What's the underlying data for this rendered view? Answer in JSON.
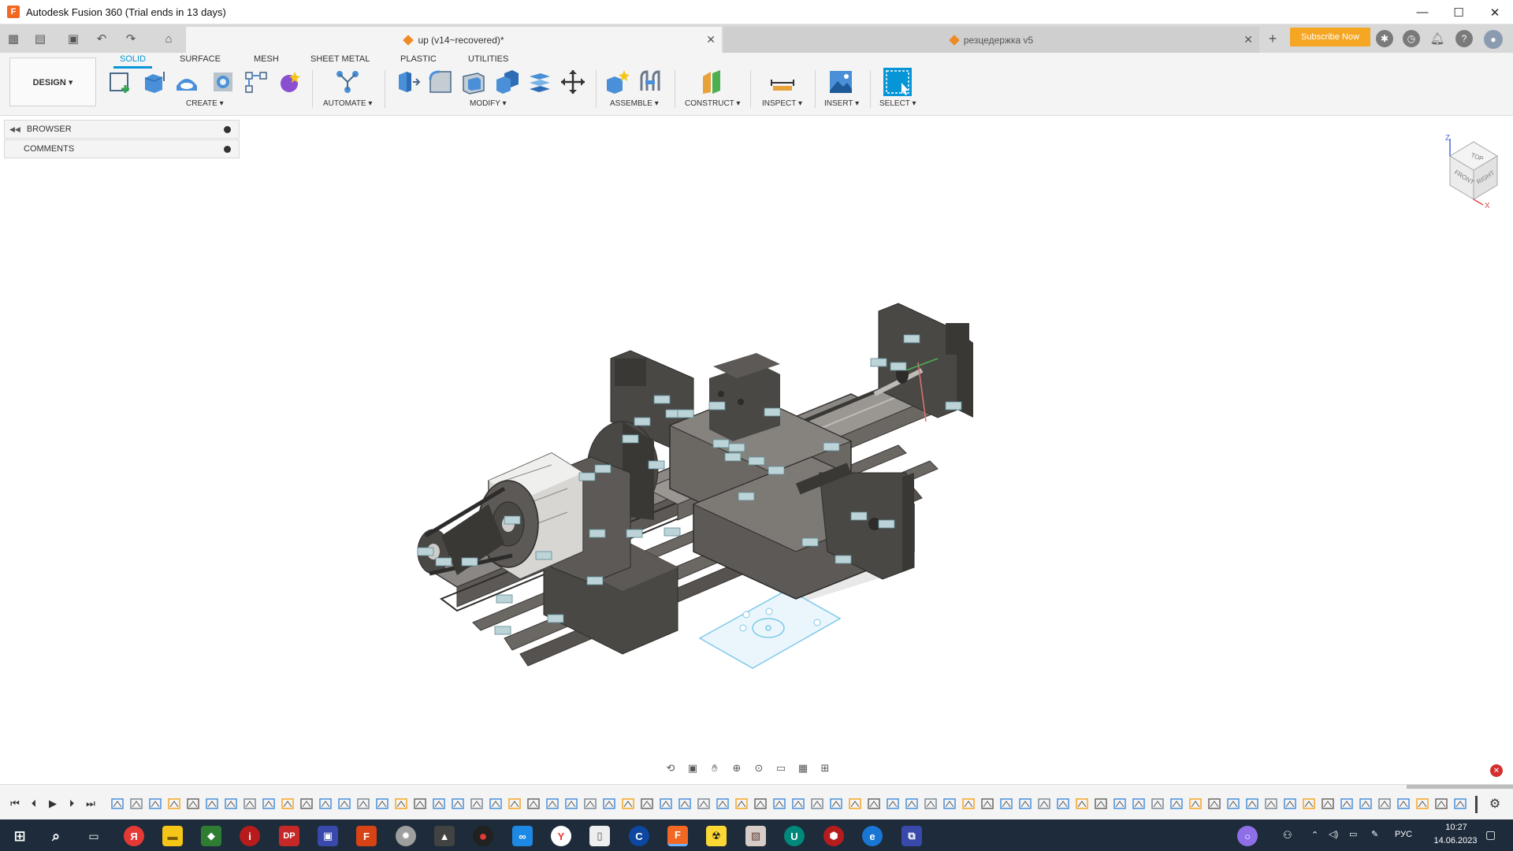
{
  "window": {
    "title": "Autodesk Fusion 360 (Trial ends in 13 days)",
    "controls": [
      "—",
      "☐",
      "✕"
    ]
  },
  "tabs": [
    {
      "label": "up (v14~recovered)*",
      "active": true
    },
    {
      "label": "резцедержка v5",
      "active": false
    }
  ],
  "subscribe_label": "Subscribe Now",
  "workspace": {
    "label": "DESIGN ▾"
  },
  "toolbar_tabs": [
    "SOLID",
    "SURFACE",
    "MESH",
    "SHEET METAL",
    "PLASTIC",
    "UTILITIES"
  ],
  "tool_groups": [
    {
      "label": "CREATE ▾"
    },
    {
      "label": "AUTOMATE ▾"
    },
    {
      "label": "MODIFY ▾"
    },
    {
      "label": "ASSEMBLE ▾"
    },
    {
      "label": "CONSTRUCT ▾"
    },
    {
      "label": "INSPECT ▾"
    },
    {
      "label": "INSERT ▾"
    },
    {
      "label": "SELECT ▾"
    }
  ],
  "panels": {
    "browser": "BROWSER",
    "comments": "COMMENTS"
  },
  "viewcube": {
    "top": "TOP",
    "front": "FRONT",
    "right": "RIGHT",
    "z": "Z",
    "x": "X"
  },
  "taskbar": {
    "lang": "РУС",
    "time": "10:27",
    "date": "14.06.2023"
  },
  "colors": {
    "accent": "#0696d7",
    "subscribe": "#f5a623",
    "taskbar": "#1d2b3a",
    "model_dark": "#4a4845",
    "model_mid": "#6b6864",
    "sketch": "#7ec8e8"
  }
}
